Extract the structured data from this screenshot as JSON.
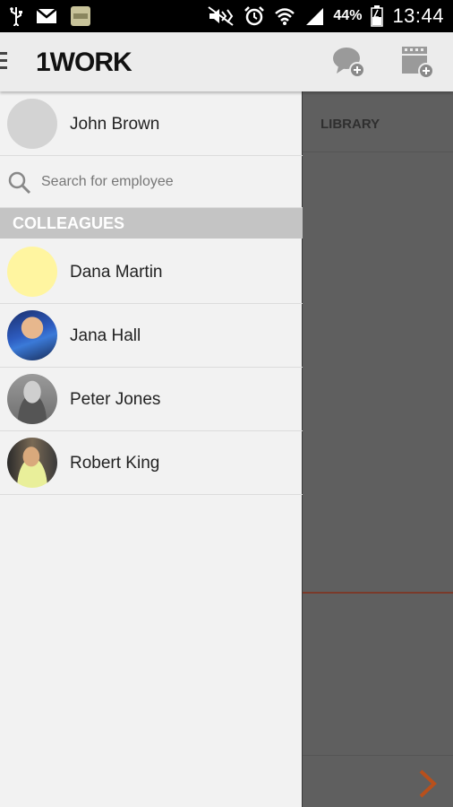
{
  "status_bar": {
    "battery_percent": "44%",
    "time": "13:44",
    "icons": [
      "usb-icon",
      "gmail-icon",
      "app-notification-icon",
      "mute-icon",
      "alarm-icon",
      "wifi-icon",
      "signal-icon",
      "battery-icon"
    ]
  },
  "app_bar": {
    "logo": "1WORK",
    "actions": [
      "new-chat-icon",
      "new-video-icon"
    ]
  },
  "current_user": {
    "name": "John Brown"
  },
  "search": {
    "placeholder": "Search for employee",
    "value": ""
  },
  "colleagues": {
    "section_title": "COLLEAGUES",
    "items": [
      {
        "name": "Dana Martin",
        "avatar": "yellow-placeholder"
      },
      {
        "name": "Jana Hall",
        "avatar": "photo"
      },
      {
        "name": "Peter Jones",
        "avatar": "photo"
      },
      {
        "name": "Robert King",
        "avatar": "photo"
      }
    ]
  },
  "background_panel": {
    "title": "LIBRARY",
    "accent_line_color": "#7a3a2a",
    "next_color": "#b8501c"
  },
  "colors": {
    "drawer_bg": "#f2f2f2",
    "appbar_bg": "#ececec",
    "section_header_bg": "#c4c4c4",
    "dim_overlay": "#5f5f5f"
  }
}
